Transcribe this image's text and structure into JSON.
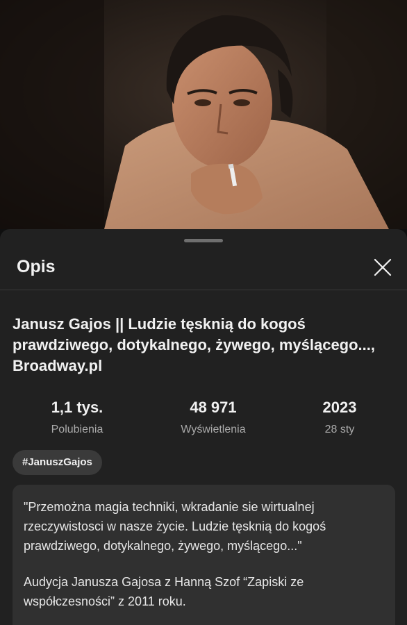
{
  "sheet": {
    "title": "Opis",
    "close_icon": "close-icon"
  },
  "video": {
    "title": "Janusz Gajos || Ludzie tęsknią do kogoś prawdziwego, dotykalnego, żywego, myślącego..., Broadway.pl",
    "stats": [
      {
        "value": "1,1 tys.",
        "label": "Polubienia"
      },
      {
        "value": "48 971",
        "label": "Wyświetlenia"
      },
      {
        "value": "2023",
        "label": "28 sty"
      }
    ],
    "hashtag": "#JanuszGajos",
    "description": [
      "\"Przemożna magia techniki, wkradanie sie wirtualnej rzeczywistosci w nasze życie. Ludzie tęsknią do kogoś prawdziwego, dotykalnego, żywego, myślącego...\"",
      "Audycja Janusza Gajosa z Hanną Szof “Zapiski ze współczesności” z 2011 roku."
    ]
  },
  "colors": {
    "sheet_bg": "#212121",
    "page_bg": "#0f0f0f",
    "card_bg": "#303030",
    "muted_text": "#aaaaaa"
  }
}
